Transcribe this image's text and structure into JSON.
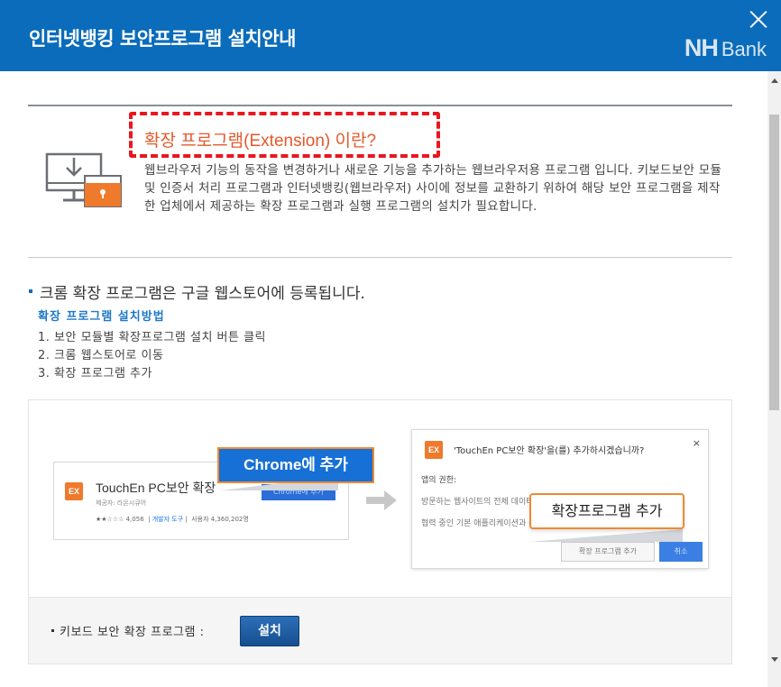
{
  "header": {
    "title": "인터넷뱅킹 보안프로그램 설치안내",
    "logo_nh": "NH",
    "logo_bank": "Bank",
    "accent_color": "#0a6cba"
  },
  "intro": {
    "heading": "확장 프로그램(Extension) 이란?",
    "description": "웹브라우저 기능의 동작을 변경하거나 새로운 기능을 추가하는 웹브라우저용 프로그램 입니다. 키보드보안 모듈 및 인증서 처리 프로그램과 인터넷뱅킹(웹브라우저) 사이에 정보를 교환하기 위하여 해당 보안 프로그램을 제작한 업체에서 제공하는 확장 프로그램과 실행 프로그램의 설치가 필요합니다."
  },
  "section": {
    "title": "크롬 확장 프로그램은 구글 웹스토어에 등록됩니다.",
    "method_title": "확장 프로그램 설치방법",
    "steps": [
      "1. 보안 모듈별 확장프로그램 설치 버튼 클릭",
      "2. 크롬 웹스토어로 이동",
      "3. 확장 프로그램 추가"
    ]
  },
  "illustration": {
    "badge": "EX",
    "store_card": {
      "name": "TouchEn PC보안 확장",
      "sub": "제공자: 라온시큐어",
      "meta_rating": "★★☆☆☆ 4,056",
      "meta_link": "개발자 도구",
      "meta_users": "사용자 4,360,202명",
      "mini_button": "Chrome에 추가"
    },
    "callout_chrome": "Chrome에 추가",
    "dialog": {
      "question": "'TouchEn PC보안 확장'을(를) 추가하시겠습니까?",
      "close": "×",
      "perm_title": "앱의 권한:",
      "perm_1": "방문하는 웹사이트의 전체 데이터 조회 및 변경",
      "perm_2": "협력 중인 기본 애플리케이션과 통신",
      "add_button": "확장 프로그램 추가",
      "cancel_button": "취소"
    },
    "callout_add": "확장프로그램 추가"
  },
  "install": {
    "label": "키보드 보안 확장 프로그램 :",
    "button": "설치"
  }
}
